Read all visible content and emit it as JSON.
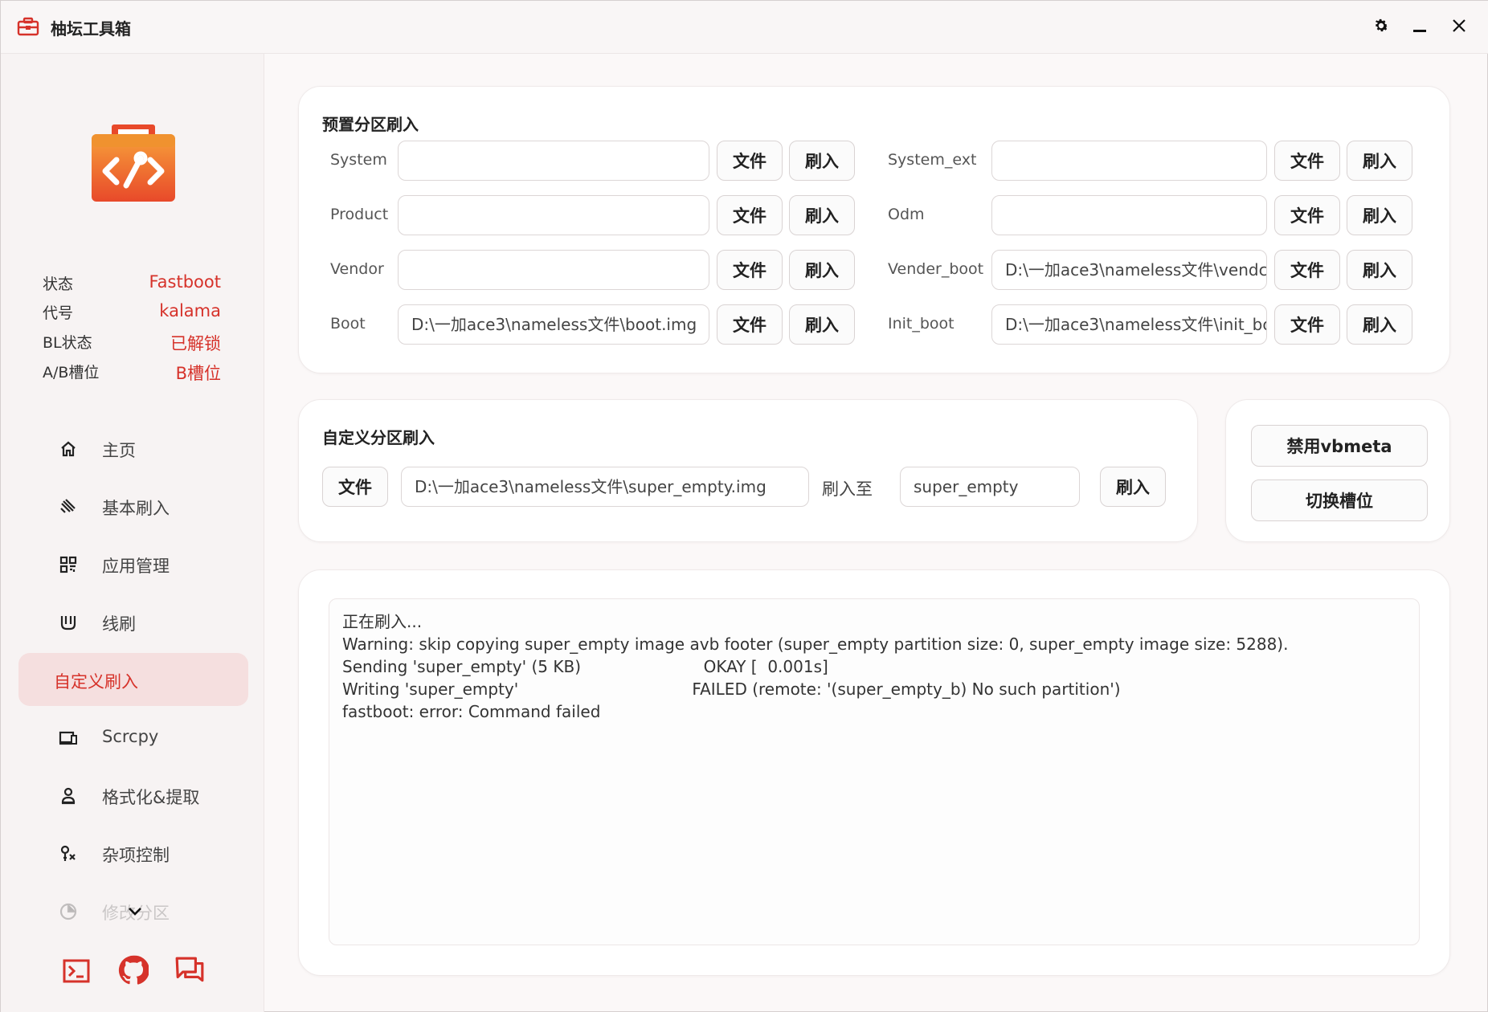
{
  "app": {
    "title": "柚坛工具箱"
  },
  "colors": {
    "accent": "#d6322a",
    "active_bg": "#f5dfdf"
  },
  "titlebar": {
    "icons": [
      "toolbox-icon",
      "gear-icon",
      "minimize-icon",
      "close-icon"
    ]
  },
  "status": [
    {
      "label": "状态",
      "value": "Fastboot"
    },
    {
      "label": "代号",
      "value": "kalama"
    },
    {
      "label": "BL状态",
      "value": "已解锁"
    },
    {
      "label": "A/B槽位",
      "value": "B槽位"
    }
  ],
  "nav": [
    {
      "label": "主页",
      "icon": "home-icon"
    },
    {
      "label": "基本刷入",
      "icon": "flash-icon"
    },
    {
      "label": "应用管理",
      "icon": "apps-icon"
    },
    {
      "label": "线刷",
      "icon": "wire-flash-icon"
    },
    {
      "label": "自定义刷入",
      "icon": "",
      "active": true
    },
    {
      "label": "Scrcpy",
      "icon": "screen-icon"
    },
    {
      "label": "格式化&提取",
      "icon": "format-icon"
    },
    {
      "label": "杂项控制",
      "icon": "misc-icon"
    },
    {
      "label": "修改分区",
      "icon": "partition-icon"
    }
  ],
  "bottom_icons": [
    "terminal-icon",
    "github-icon",
    "feedback-icon"
  ],
  "preset": {
    "title": "预置分区刷入",
    "file_label": "文件",
    "flash_label": "刷入",
    "left": [
      {
        "name": "System",
        "value": ""
      },
      {
        "name": "Product",
        "value": ""
      },
      {
        "name": "Vendor",
        "value": ""
      },
      {
        "name": "Boot",
        "value": "D:\\一加ace3\\nameless文件\\boot.img"
      }
    ],
    "right": [
      {
        "name": "System_ext",
        "value": ""
      },
      {
        "name": "Odm",
        "value": ""
      },
      {
        "name": "Vender_boot",
        "value": "D:\\一加ace3\\nameless文件\\vendc"
      },
      {
        "name": "Init_boot",
        "value": "D:\\一加ace3\\nameless文件\\init_bc"
      }
    ]
  },
  "custom": {
    "title": "自定义分区刷入",
    "file_label": "文件",
    "file_path": "D:\\一加ace3\\nameless文件\\super_empty.img",
    "flash_to_label": "刷入至",
    "partition": "super_empty",
    "flash_label": "刷入"
  },
  "actions": {
    "disable_vbmeta": "禁用vbmeta",
    "switch_slot": "切换槽位"
  },
  "log": [
    "正在刷入...",
    "Warning: skip copying super_empty image avb footer (super_empty partition size: 0, super_empty image size: 5288).",
    "Sending 'super_empty' (5 KB)                        OKAY [  0.001s]",
    "Writing 'super_empty'                                  FAILED (remote: '(super_empty_b) No such partition')",
    "fastboot: error: Command failed"
  ]
}
